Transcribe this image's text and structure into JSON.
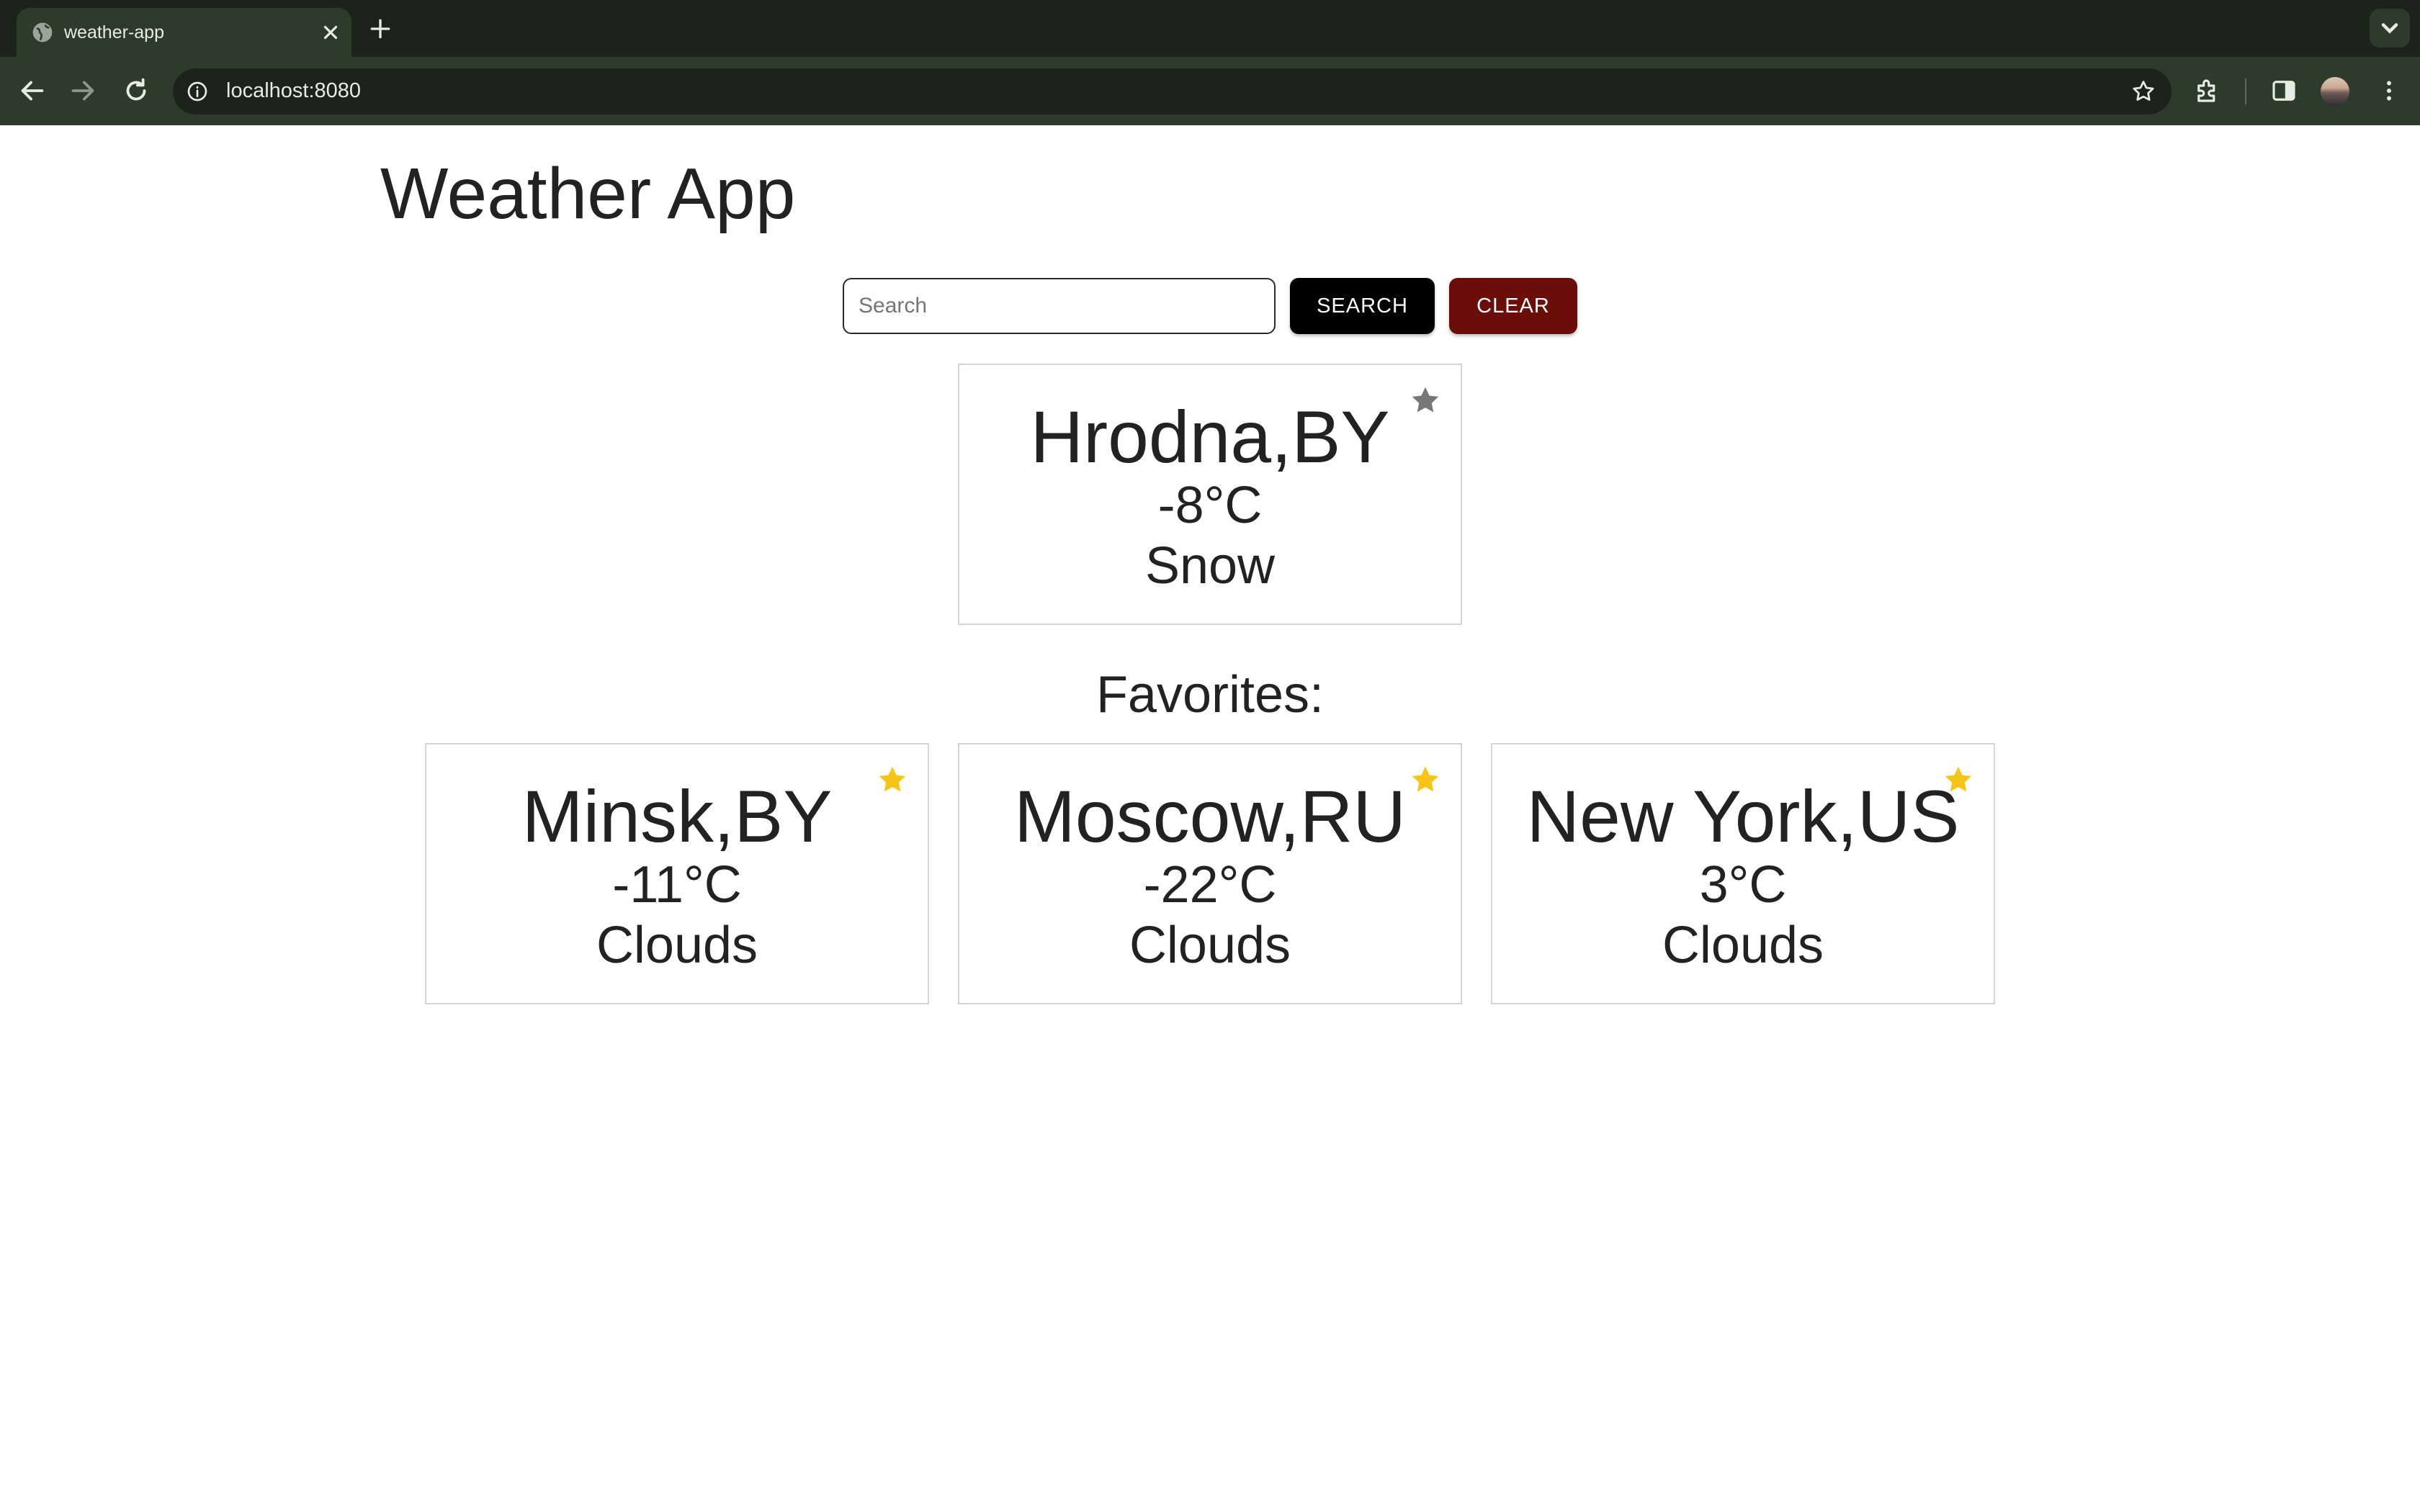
{
  "browser": {
    "tab_title": "weather-app",
    "url": "localhost:8080"
  },
  "app": {
    "title": "Weather App",
    "search": {
      "placeholder": "Search",
      "value": "",
      "search_label": "SEARCH",
      "clear_label": "CLEAR"
    },
    "current": {
      "city": "Hrodna,BY",
      "temp": "-8°C",
      "condition": "Snow",
      "favorite": false
    },
    "favorites_heading": "Favorites:",
    "favorites": [
      {
        "city": "Minsk,BY",
        "temp": "-11°C",
        "condition": "Clouds",
        "favorite": true
      },
      {
        "city": "Moscow,RU",
        "temp": "-22°C",
        "condition": "Clouds",
        "favorite": true
      },
      {
        "city": "New York,US",
        "temp": "3°C",
        "condition": "Clouds",
        "favorite": true
      }
    ]
  },
  "colors": {
    "star_active": "#f5c518",
    "star_inactive": "#777777",
    "search_button": "#000000",
    "clear_button": "#6b0e0a"
  },
  "icons": [
    "globe-icon",
    "close-icon",
    "plus-icon",
    "chevron-down-icon",
    "back-icon",
    "forward-icon",
    "reload-icon",
    "info-icon",
    "bookmark-star-icon",
    "extensions-icon",
    "side-panel-icon",
    "avatar",
    "menu-icon",
    "star-icon"
  ]
}
